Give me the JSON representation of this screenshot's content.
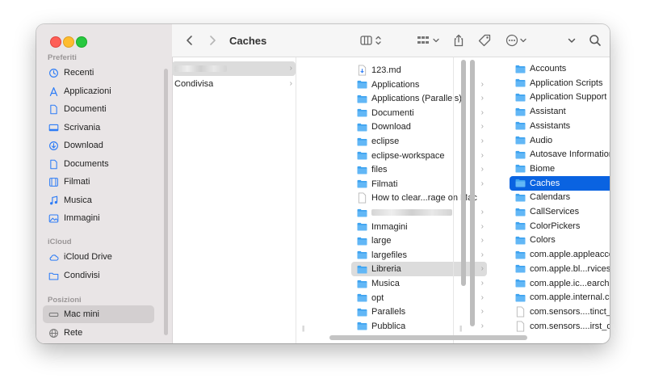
{
  "window": {
    "title": "Caches"
  },
  "sidebar": {
    "sections": [
      {
        "header": "Preferiti",
        "items": [
          {
            "label": "Recenti",
            "icon": "clock-icon"
          },
          {
            "label": "Applicazioni",
            "icon": "applications-icon"
          },
          {
            "label": "Documenti",
            "icon": "document-icon"
          },
          {
            "label": "Scrivania",
            "icon": "desktop-icon"
          },
          {
            "label": "Download",
            "icon": "download-icon"
          },
          {
            "label": "Documents",
            "icon": "document-icon"
          },
          {
            "label": "Filmati",
            "icon": "film-icon"
          },
          {
            "label": "Musica",
            "icon": "music-icon"
          },
          {
            "label": "Immagini",
            "icon": "photo-icon"
          }
        ]
      },
      {
        "header": "iCloud",
        "items": [
          {
            "label": "iCloud Drive",
            "icon": "cloud-icon"
          },
          {
            "label": "Condivisi",
            "icon": "shared-folder-icon"
          }
        ]
      },
      {
        "header": "Posizioni",
        "items": [
          {
            "label": "Mac mini",
            "icon": "computer-icon",
            "selected": true
          },
          {
            "label": "Rete",
            "icon": "globe-icon"
          }
        ]
      }
    ]
  },
  "toolbar": {
    "back_icon": "chevron-left-icon",
    "forward_icon": "chevron-right-icon",
    "view_icon": "column-view-icon",
    "group_icon": "group-icon",
    "share_icon": "share-icon",
    "tag_icon": "tag-icon",
    "more_icon": "ellipsis-icon",
    "overflow_icon": "chevron-down-icon",
    "search_icon": "search-icon"
  },
  "columns": [
    {
      "items": [
        {
          "label": "",
          "blurred": true,
          "selected": "gray",
          "chevron": true
        },
        {
          "label": "Condivisa",
          "chevron": true
        }
      ]
    },
    {
      "items": [
        {
          "label": "123.md",
          "type": "file-md"
        },
        {
          "label": "Applications",
          "type": "folder",
          "chevron": true
        },
        {
          "label": "Applications (Parallels)",
          "type": "folder",
          "chevron": true
        },
        {
          "label": "Documenti",
          "type": "folder",
          "chevron": true
        },
        {
          "label": "Download",
          "type": "folder",
          "chevron": true
        },
        {
          "label": "eclipse",
          "type": "folder",
          "chevron": true
        },
        {
          "label": "eclipse-workspace",
          "type": "folder",
          "chevron": true
        },
        {
          "label": "files",
          "type": "folder",
          "chevron": true
        },
        {
          "label": "Filmati",
          "type": "folder",
          "chevron": true
        },
        {
          "label": "How to clear...rage on Mac",
          "type": "file"
        },
        {
          "label": "",
          "type": "folder",
          "blurred": true,
          "chevron": true
        },
        {
          "label": "Immagini",
          "type": "folder",
          "chevron": true
        },
        {
          "label": "large",
          "type": "folder",
          "chevron": true
        },
        {
          "label": "largefiles",
          "type": "folder",
          "chevron": true
        },
        {
          "label": "Libreria",
          "type": "folder",
          "chevron": true,
          "selected": "gray"
        },
        {
          "label": "Musica",
          "type": "folder",
          "chevron": true
        },
        {
          "label": "opt",
          "type": "folder",
          "chevron": true
        },
        {
          "label": "Parallels",
          "type": "folder",
          "chevron": true
        },
        {
          "label": "Pubblica",
          "type": "folder",
          "chevron": true
        }
      ]
    },
    {
      "items": [
        {
          "label": "Accounts",
          "type": "folder",
          "chevron": true
        },
        {
          "label": "Application Scripts",
          "type": "folder",
          "chevron": true
        },
        {
          "label": "Application Support",
          "type": "folder",
          "chevron": true
        },
        {
          "label": "Assistant",
          "type": "folder",
          "chevron": true
        },
        {
          "label": "Assistants",
          "type": "folder",
          "chevron": true
        },
        {
          "label": "Audio",
          "type": "folder",
          "chevron": true
        },
        {
          "label": "Autosave Information",
          "type": "folder",
          "chevron": true
        },
        {
          "label": "Biome",
          "type": "folder",
          "chevron": true
        },
        {
          "label": "Caches",
          "type": "folder",
          "chevron": true,
          "selected": "blue"
        },
        {
          "label": "Calendars",
          "type": "folder",
          "chevron": true
        },
        {
          "label": "CallServices",
          "type": "folder",
          "chevron": true
        },
        {
          "label": "ColorPickers",
          "type": "folder",
          "chevron": true
        },
        {
          "label": "Colors",
          "type": "folder",
          "chevron": true
        },
        {
          "label": "com.apple.appleaccountd",
          "type": "folder",
          "chevron": true
        },
        {
          "label": "com.apple.bl...rvices.cloud",
          "type": "folder",
          "chevron": true
        },
        {
          "label": "com.apple.ic...earchpartyd",
          "type": "folder",
          "chevron": true
        },
        {
          "label": "com.apple.internal.ck",
          "type": "folder",
          "chevron": true
        },
        {
          "label": "com.sensors....tinct_id.plist",
          "type": "file"
        },
        {
          "label": "com.sensors....irst_day.plist",
          "type": "file"
        }
      ]
    }
  ],
  "colors": {
    "accent": "#0a63e1",
    "folder": "#3ea3f0",
    "sidebar_bg": "#e9e5e6"
  }
}
